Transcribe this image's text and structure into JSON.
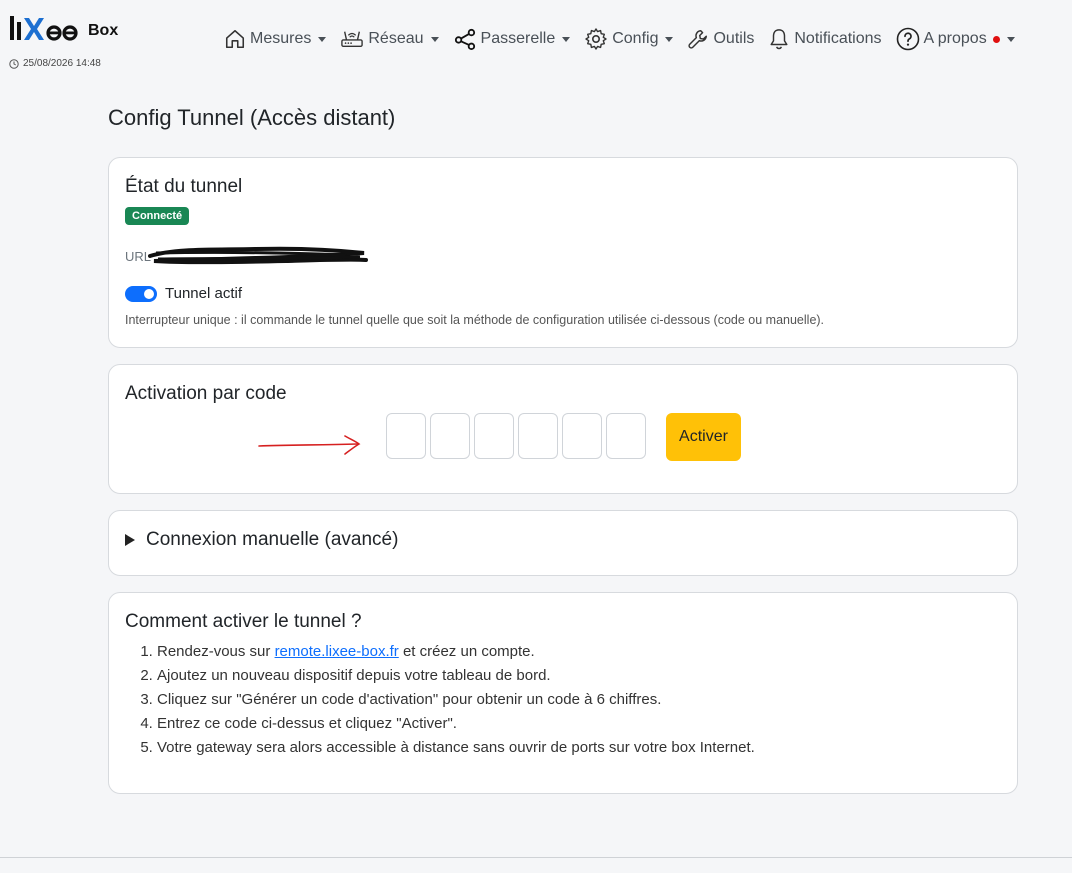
{
  "brand": {
    "logo_text": "lixee",
    "box": "Box",
    "datetime": "25/08/2026 14:48"
  },
  "nav": {
    "items": [
      {
        "label": "Mesures",
        "icon": "home-icon",
        "dropdown": true
      },
      {
        "label": "Réseau",
        "icon": "router-icon",
        "dropdown": true
      },
      {
        "label": "Passerelle",
        "icon": "network-nodes-icon",
        "dropdown": true
      },
      {
        "label": "Config",
        "icon": "gear-icon",
        "dropdown": true
      },
      {
        "label": "Outils",
        "icon": "wrench-icon",
        "dropdown": false
      },
      {
        "label": "Notifications",
        "icon": "bell-icon",
        "dropdown": false
      },
      {
        "label": "A propos",
        "icon": "question-circle-icon",
        "dropdown": true
      }
    ]
  },
  "page": {
    "title": "Config Tunnel (Accès distant)"
  },
  "status": {
    "title": "État du tunnel",
    "badge": "Connecté",
    "url_label": "URL :",
    "switch_label": "Tunnel actif",
    "switch_on": true,
    "note": "Interrupteur unique : il commande le tunnel quelle que soit la méthode de configuration utilisée ci-dessous (code ou manuelle)."
  },
  "activation": {
    "title": "Activation par code",
    "button": "Activer",
    "code_digits": [
      "",
      "",
      "",
      "",
      "",
      ""
    ]
  },
  "manual": {
    "summary": "Connexion manuelle (avancé)"
  },
  "howto": {
    "title": "Comment activer le tunnel ?",
    "step1_before": "Rendez-vous sur ",
    "step1_link": "remote.lixee-box.fr",
    "step1_after": " et créez un compte.",
    "step2": "Ajoutez un nouveau dispositif depuis votre tableau de bord.",
    "step3": "Cliquez sur \"Générer un code d'activation\" pour obtenir un code à 6 chiffres.",
    "step4": "Entrez ce code ci-dessus et cliquez \"Activer\".",
    "step5": "Votre gateway sera alors accessible à distance sans ouvrir de ports sur votre box Internet."
  },
  "colors": {
    "accent": "#0d6efd",
    "badge_green": "#198754",
    "button_yellow": "#ffc107",
    "notification_dot": "#e01010",
    "annotation_arrow": "#d62020"
  }
}
